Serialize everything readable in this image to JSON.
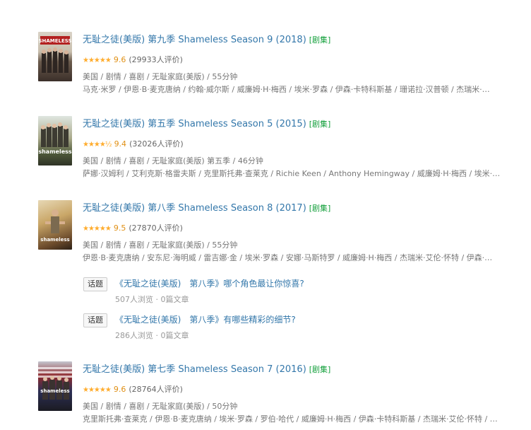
{
  "results": [
    {
      "title": "无耻之徒(美版) 第九季 Shameless Season 9 (2018)",
      "tag": "[剧集]",
      "stars": "★★★★★",
      "score": "9.6",
      "votes": "(29933人评价)",
      "meta": "美国 / 剧情 / 喜剧 / 无耻家庭(美版) / 55分钟",
      "cast": "马克·米罗 / 伊恩·B·麦克唐纳 / 约翰·威尔斯 / 威廉姆·H·梅西 / 埃米·罗森 / 伊森·卡特科斯基 / 珊诺拉·汉普顿 / 杰瑞米·…",
      "poster_label": "SHAMELESS"
    },
    {
      "title": "无耻之徒(美版) 第五季 Shameless Season 5 (2015)",
      "tag": "[剧集]",
      "stars": "★★★★½",
      "score": "9.4",
      "votes": "(32026人评价)",
      "meta": "美国 / 剧情 / 喜剧 / 无耻家庭(美版) 第五季 / 46分钟",
      "cast": "萨娜·汉姆利 / 艾利克斯·格雷夫斯 / 克里斯托弗·查莱克 / Richie Keen / Anthony Hemingway / 威廉姆·H·梅西 / 埃米·…",
      "poster_label": "shameless"
    },
    {
      "title": "无耻之徒(美版) 第八季 Shameless Season 8 (2017)",
      "tag": "[剧集]",
      "stars": "★★★★★",
      "score": "9.5",
      "votes": "(27870人评价)",
      "meta": "美国 / 剧情 / 喜剧 / 无耻家庭(美版) / 55分钟",
      "cast": "伊恩·B·麦克唐纳 / 安东尼·海明威 / 雷吉娜·金 / 埃米·罗森 / 安娜·马斯特罗 / 威廉姆·H·梅西 / 杰瑞米·艾伦·怀特 / 伊森·…",
      "poster_label": "shameless"
    },
    {
      "title": "无耻之徒(美版) 第七季 Shameless Season 7 (2016)",
      "tag": "[剧集]",
      "stars": "★★★★★",
      "score": "9.6",
      "votes": "(28764人评价)",
      "meta": "美国 / 剧情 / 喜剧 / 无耻家庭(美版) / 50分钟",
      "cast": "克里斯托弗·查莱克 / 伊恩·B·麦克唐纳 / 埃米·罗森 / 罗伯·哈代 / 威廉姆·H·梅西 / 伊森·卡特科斯基 / 杰瑞米·艾伦·怀特 / …",
      "poster_label": "shameless"
    }
  ],
  "topics": [
    {
      "button": "话题",
      "title": "《无耻之徒(美版)　第八季》哪个角色最让你惊喜?",
      "stats": "507人浏览 · 0篇文章"
    },
    {
      "button": "话题",
      "title": "《无耻之徒(美版)　第八季》有哪些精彩的细节?",
      "stats": "286人浏览 · 0篇文章"
    }
  ],
  "colors": {
    "link": "#3377aa",
    "tag": "#14a03c",
    "star": "#ffac2d",
    "score": "#e09015"
  }
}
